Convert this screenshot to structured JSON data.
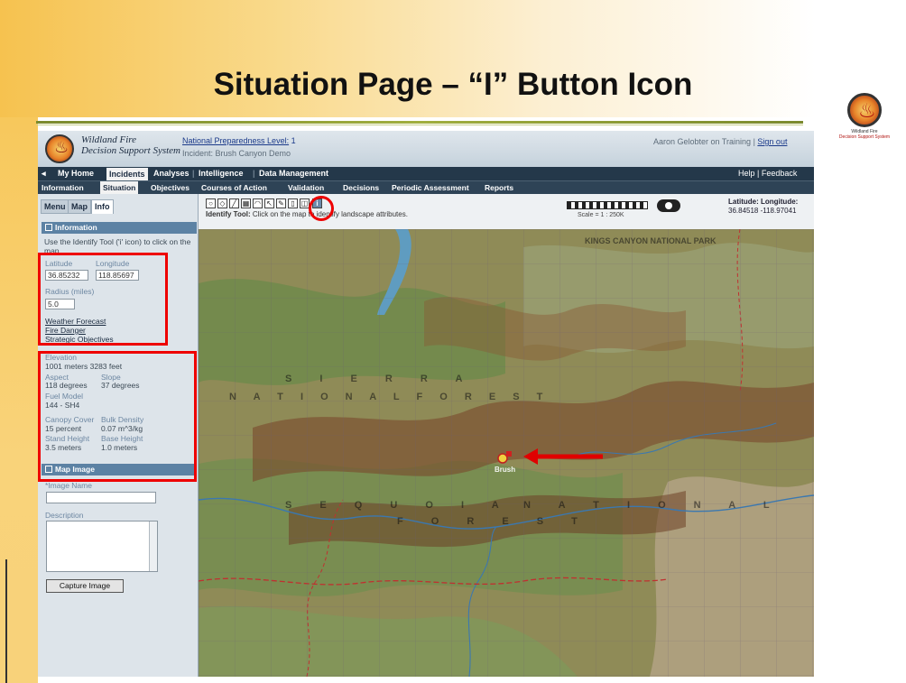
{
  "slide": {
    "title": "Situation Page – “I” Button Icon",
    "logo_text_1": "Wildland Fire",
    "logo_text_2": "Decision Support System"
  },
  "app": {
    "name_line1": "Wildland Fire",
    "name_line2": "Decision Support System",
    "preparedness_label": "National Preparedness Level:",
    "preparedness_value": "1",
    "incident": "Incident: Brush Canyon Demo",
    "user": "Aaron Gelobter on Training |",
    "signout": "Sign out",
    "nav_primary": [
      "My Home",
      "Incidents",
      "Analyses",
      "Intelligence",
      "Data Management"
    ],
    "nav_primary_active": "Incidents",
    "help_feedback": "Help | Feedback",
    "nav_secondary": [
      "Information",
      "Situation",
      "Objectives",
      "Courses of Action",
      "Validation",
      "Decisions",
      "Periodic Assessment",
      "Reports"
    ],
    "nav_secondary_active": "Situation"
  },
  "panel": {
    "tabs": [
      "Menu",
      "Map",
      "Info"
    ],
    "active_tab": "Info",
    "information_header": "Information",
    "instructions": "Use the Identify Tool ('i' icon) to click on the map.",
    "latitude_label": "Latitude",
    "latitude_value": "36.85232",
    "longitude_label": "Longitude",
    "longitude_value": "118.85697",
    "radius_label": "Radius (miles)",
    "radius_value": "5.0",
    "links": [
      "Weather Forecast",
      "Fire Danger",
      "Strategic Objectives"
    ],
    "elevation_label": "Elevation",
    "elevation_value": "1001 meters 3283 feet",
    "aspect_label": "Aspect",
    "aspect_value": "118 degrees",
    "slope_label": "Slope",
    "slope_value": "37 degrees",
    "fuel_model_label": "Fuel Model",
    "fuel_model_value": "144 - SH4",
    "canopy_cover_label": "Canopy Cover",
    "canopy_cover_value": "15 percent",
    "bulk_density_label": "Bulk Density",
    "bulk_density_value": "0.07 m^3/kg",
    "stand_height_label": "Stand Height",
    "stand_height_value": "3.5 meters",
    "base_height_label": "Base Height",
    "base_height_value": "1.0 meters",
    "map_image_header": "Map Image",
    "image_name_label": "*Image Name",
    "description_label": "Description",
    "capture_button": "Capture Image"
  },
  "toolbar": {
    "tool_names": [
      "circle-tool",
      "polygon-tool",
      "line-tool",
      "grid-tool",
      "area-tool",
      "pointer-tool",
      "draw-tool",
      "erase-tool",
      "layers-tool",
      "identify-tool"
    ],
    "identify_glyph": "i",
    "tooltip_bold": "Identify Tool:",
    "tooltip_text": "Click on the map to identify landscape attributes.",
    "scale_label": "Scale = 1 : 250K",
    "latlon_header": "Latitude:   Longitude:",
    "latlon_value": "36.84518  -118.97041"
  },
  "map": {
    "labels": [
      "KINGS CANYON NATIONAL PARK",
      "S I E R R A",
      "N A T I O N A L   F O R E S T",
      "S E Q U O I A",
      "N A T I O N A L",
      "F O R E S T"
    ],
    "fire_label": "Brush"
  },
  "colors": {
    "annotation_red": "#e00000",
    "nav_dark": "#24384a",
    "section_blue": "#5c82a4",
    "title_rule": "#7b8a2e"
  }
}
